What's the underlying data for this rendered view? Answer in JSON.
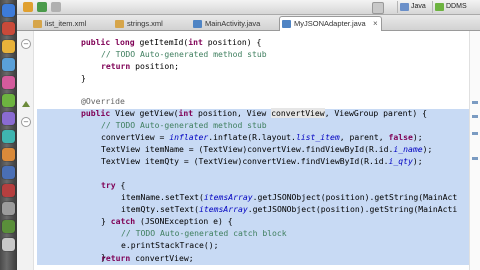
{
  "toolbar": {
    "perspectives": [
      {
        "label": "Java",
        "icon": "java-perspective-icon"
      },
      {
        "label": "DDMS",
        "icon": "ddms-perspective-icon"
      }
    ]
  },
  "tabs": [
    {
      "label": "list_item.xml",
      "icon": "xml-file-icon",
      "active": false
    },
    {
      "label": "strings.xml",
      "icon": "xml-file-icon",
      "active": false
    },
    {
      "label": "MainActivity.java",
      "icon": "java-file-icon",
      "active": false
    },
    {
      "label": "MyJSONAdapter.java",
      "icon": "java-file-icon",
      "active": true,
      "close": "×"
    }
  ],
  "code": {
    "l1": {
      "a": "public",
      "b": " ",
      "c": "long",
      "d": " getItemId(",
      "e": "int",
      "f": " position) {"
    },
    "l2": {
      "a": "// TODO Auto-generated method stub"
    },
    "l3": {
      "a": "return",
      "b": " position;"
    },
    "l4": {
      "a": "}"
    },
    "l5": {
      "a": "@Override"
    },
    "l6": {
      "a": "public",
      "b": " View getView(",
      "c": "int",
      "d": " position, View ",
      "e": "convertView",
      "f": ", ViewGroup parent) {"
    },
    "l7": {
      "a": "// TODO Auto-generated method stub"
    },
    "l8": {
      "a": "convertView = ",
      "b": "inflater",
      "c": ".inflate(R.layout.",
      "d": "list_item",
      "e": ", parent, ",
      "f": "false",
      "g": ");"
    },
    "l9": {
      "a": "TextView itemName = (TextView)convertView.findViewById(R.id.",
      "b": "i_name",
      "c": ");"
    },
    "l10": {
      "a": "TextView itemQty = (TextView)convertView.findViewById(R.id.",
      "b": "i_qty",
      "c": ");"
    },
    "l11": {
      "a": "try",
      "b": " {"
    },
    "l12": {
      "a": "itemName.setText(",
      "b": "itemsArray",
      "c": ".getJSONObject(position).getString(MainAct"
    },
    "l13": {
      "a": "itemQty.setText(",
      "b": "itemsArray",
      "c": ".getJSONObject(position).getString(MainActi"
    },
    "l14": {
      "a": "} ",
      "b": "catch",
      "c": " (JSONException e) {"
    },
    "l15": {
      "a": "// TODO Auto-generated catch block"
    },
    "l16": {
      "a": "e.printStackTrace();"
    },
    "l17": {
      "a": "}"
    },
    "l18": {
      "a": "return",
      "b": " convertView;"
    },
    "l19": {
      "a": "}"
    }
  },
  "colors": {
    "keyword": "#7f0055",
    "comment": "#3f7f5f",
    "annotation": "#646464",
    "field": "#0000c0",
    "selection": "#c8daf4"
  }
}
